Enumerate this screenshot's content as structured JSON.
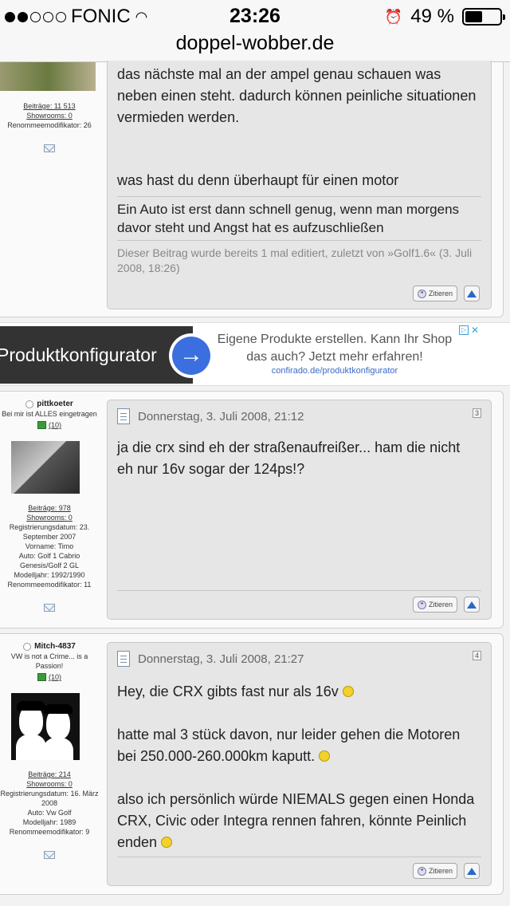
{
  "status": {
    "carrier": "FONIC",
    "time": "23:26",
    "battery": "49 %",
    "battery_level": 0.49,
    "signal_filled": 2,
    "signal_total": 5
  },
  "url": "doppel-wobber.de",
  "post2": {
    "user_stats": {
      "posts": "Beiträge: 11 513",
      "showrooms": "Showrooms: 0",
      "reputation": "Renommeemodifikator: 26"
    },
    "text1": "das nächste mal an der ampel genau schauen was neben einen steht. dadurch können peinliche situationen vermieden werden.",
    "text2": "was hast du denn überhaupt für einen motor",
    "signature": "Ein Auto ist erst dann schnell genug, wenn man morgens davor steht und Angst hat es aufzuschließen",
    "edit_note": "Dieser Beitrag wurde bereits 1 mal editiert, zuletzt von »Golf1.6« (3. Juli 2008, 18:26)",
    "quote_label": "Zitieren"
  },
  "ad": {
    "left_text": "Produktkonfigurator",
    "text": "Eigene Produkte erstellen. Kann Ihr Shop das auch? Jetzt mehr erfahren!",
    "domain": "confirado.de/produktkonfigurator"
  },
  "post3": {
    "username": "pittkoeter",
    "user_title": "Bei mir ist ALLES eingetragen",
    "rank": "(10)",
    "posts": "Beiträge: 978",
    "showrooms": "Showrooms: 0",
    "reg": "Registrierungsdatum: 23. September 2007",
    "vorname": "Vorname: Timo",
    "auto": "Auto: Golf 1 Cabrio Genesis/Golf 2 GL",
    "modelljahr": "Modelljahr: 1992/1990",
    "reputation": "Renommeemodifikator: 11",
    "date": "Donnerstag, 3. Juli 2008, 21:12",
    "number": "3",
    "text": "ja die crx sind eh der straßenaufreißer... ham die nicht eh nur 16v sogar der 124ps!?",
    "quote_label": "Zitieren"
  },
  "post4": {
    "username": "Mitch-4837",
    "user_title": "VW is not a Crime... is a Passion!",
    "rank": "(10)",
    "posts": "Beiträge: 214",
    "showrooms": "Showrooms: 0",
    "reg": "Registrierungsdatum: 16. März 2008",
    "auto": "Auto: Vw Golf",
    "modelljahr": "Modelljahr: 1989",
    "reputation": "Renommeemodifikator: 9",
    "date": "Donnerstag, 3. Juli 2008, 21:27",
    "number": "4",
    "line1": "Hey, die CRX gibts fast nur als 16v",
    "line2": "hatte mal 3 stück davon, nur leider gehen die Motoren bei 250.000-260.000km kaputt.",
    "line3": "also ich persönlich würde NIEMALS gegen einen Honda CRX, Civic oder Integra rennen fahren, könnte Peinlich enden",
    "quote_label": "Zitieren"
  }
}
